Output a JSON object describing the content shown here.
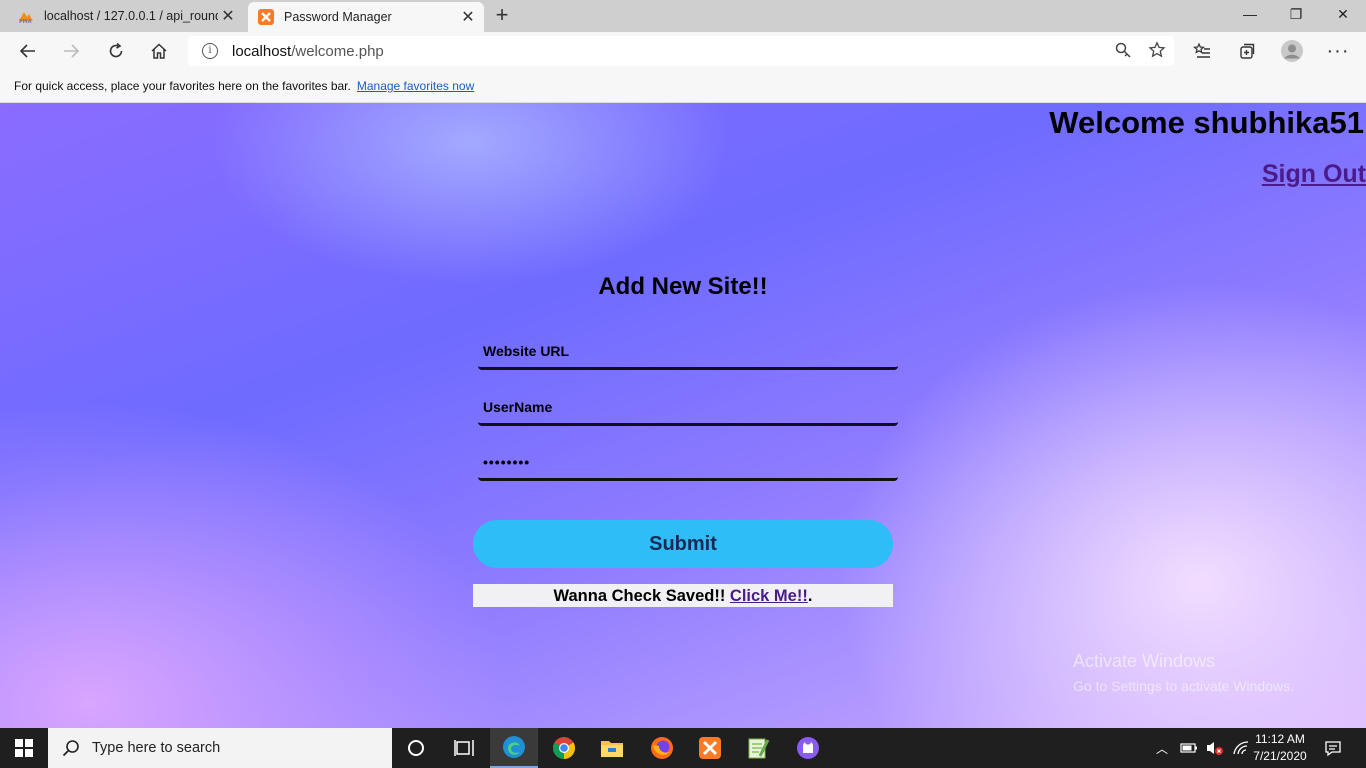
{
  "browser": {
    "tabs": [
      {
        "label": "localhost / 127.0.0.1 / api_round",
        "active": false
      },
      {
        "label": "Password Manager",
        "active": true
      }
    ],
    "address": {
      "host": "localhost",
      "path": "/welcome.php"
    },
    "favorites_bar": {
      "message": "For quick access, place your favorites here on the favorites bar.",
      "link": "Manage favorites now"
    }
  },
  "page": {
    "welcome": "Welcome shubhika51",
    "sign_out": "Sign Out",
    "form_title": "Add New Site!!",
    "fields": {
      "website_url": "Website URL",
      "username": "UserName",
      "password": "••••••••"
    },
    "submit": "Submit",
    "check_saved": {
      "text": "Wanna Check Saved!! ",
      "link": "Click Me!!",
      "suffix": "."
    }
  },
  "watermark": {
    "line1": "Activate Windows",
    "line2": "Go to Settings to activate Windows."
  },
  "taskbar": {
    "search_placeholder": "Type here to search",
    "time": "11:12 AM",
    "date": "7/21/2020"
  },
  "colors": {
    "submit_bg": "#2ebdf7",
    "link_purple": "#4a1b8a",
    "page_gradient_start": "#8a6cff",
    "page_gradient_end": "#d6b3ff"
  }
}
